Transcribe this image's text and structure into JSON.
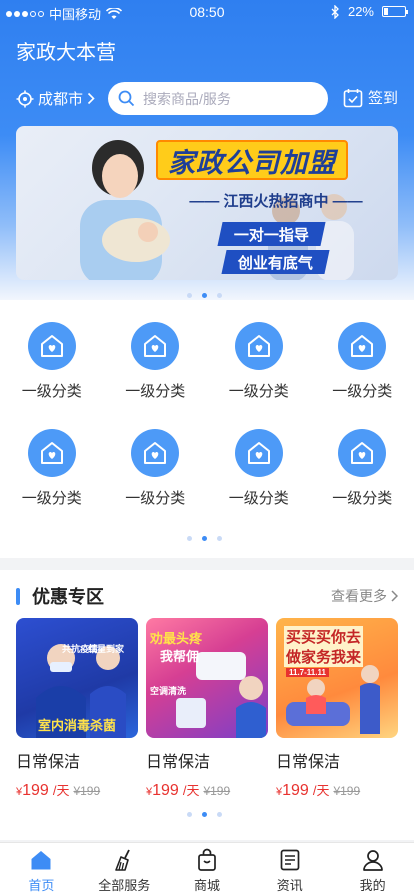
{
  "status": {
    "carrier": "中国移动",
    "time": "08:50",
    "battery": "22%",
    "battery_level": 0.22
  },
  "header": {
    "title": "家政大本营",
    "city": "成都市",
    "search_placeholder": "搜索商品/服务",
    "signin_label": "签到"
  },
  "banner": {
    "title_part1": "家政公司",
    "title_part2": "加盟",
    "subtitle": "—— 江西火热招商中 ——",
    "tag1": "一对一指导",
    "tag2": "创业有底气",
    "pages": 3,
    "active_page": 1
  },
  "categories": {
    "items": [
      {
        "label": "一级分类"
      },
      {
        "label": "一级分类"
      },
      {
        "label": "一级分类"
      },
      {
        "label": "一级分类"
      },
      {
        "label": "一级分类"
      },
      {
        "label": "一级分类"
      },
      {
        "label": "一级分类"
      },
      {
        "label": "一级分类"
      }
    ],
    "pages": 3,
    "active_page": 1
  },
  "deals": {
    "title": "优惠专区",
    "more_label": "查看更多",
    "items": [
      {
        "name": "日常保洁",
        "currency": "¥",
        "price": "199",
        "unit": "/天",
        "old_price": "¥199",
        "img_line1": "共抗疫情",
        "img_line2": "红星到家",
        "img_line3": "室内消毒杀菌"
      },
      {
        "name": "日常保洁",
        "currency": "¥",
        "price": "199",
        "unit": "/天",
        "old_price": "¥199",
        "img_line1": "劝最头疼",
        "img_line2": "我帮佣",
        "img_line3": "空调清洗"
      },
      {
        "name": "日常保洁",
        "currency": "¥",
        "price": "199",
        "unit": "/天",
        "old_price": "¥199",
        "img_line1": "买买买你去",
        "img_line2": "做家务我来",
        "img_line3": "11.7-11.11"
      }
    ],
    "pages": 3,
    "active_page": 1
  },
  "tabbar": {
    "items": [
      {
        "label": "首页",
        "icon": "home-icon",
        "active": true
      },
      {
        "label": "全部服务",
        "icon": "broom-icon",
        "active": false
      },
      {
        "label": "商城",
        "icon": "shopping-bag-icon",
        "active": false
      },
      {
        "label": "资讯",
        "icon": "news-icon",
        "active": false
      },
      {
        "label": "我的",
        "icon": "user-icon",
        "active": false
      }
    ]
  },
  "colors": {
    "primary": "#3d8cf5",
    "price": "#e8322f"
  }
}
